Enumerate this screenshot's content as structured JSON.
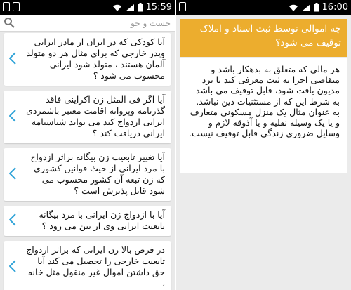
{
  "left": {
    "status": {
      "time": "15:59"
    },
    "search": {
      "placeholder": "جست و جو"
    },
    "questions": [
      {
        "text": "آیا کودکی که در ایران از مادر ایرانی وپدر خارجی که برای مثال هر دو متولد آلمان هستند ، متولد شود ایرانی محسوب می شود ؟"
      },
      {
        "text": "آیا اگر فی المثل زن اکراینی فاقد گذرنامه وپروانه اقامت معتبر باشمردی ایرانی ازدواج کند می تواند شناسنامه ایرانی دریافت کند ؟"
      },
      {
        "text": "آیا تغییر تابعیت زن بیگانه براثر ازدواج با مرد ایرانی از حیث قوانین کشوری که زن تبعه آن کشور محسوب می شود قابل پذیرش است ؟"
      },
      {
        "text": "آیا با ازدواج زن ایرانی با مرد بیگانه تابعیت ایرانی وی از بین می رود ؟"
      },
      {
        "text": "در فرض بالا زن ایرانی که براثر ازدواج تابعیت خارجی را تحصیل می کند آیا حق داشتن اموال غیر منقول مثل خانه ،"
      }
    ]
  },
  "right": {
    "status": {
      "time": "16:00"
    },
    "title": "چه اموالی توسط ثبت اسناد و املاک توقیف می شود؟",
    "body": "هر مالی که متعلق به بدهکار باشد و متقاضی اجرا به ثبت معرفی کند یا نزد مدیون یافت شود، قابل توقیف می باشد به شرط این که از مستثنیات دین نباشد. به عنوان مثال یک منزل مسکونی متعارف و یا یک وسیله نقلیه و یا آذوقه لازم و وسایل ضروری زندگی قابل توقیف نیست."
  },
  "colors": {
    "accent": "#ecad2e",
    "chevron": "#2fa3d8",
    "statusbar": "#000000"
  }
}
